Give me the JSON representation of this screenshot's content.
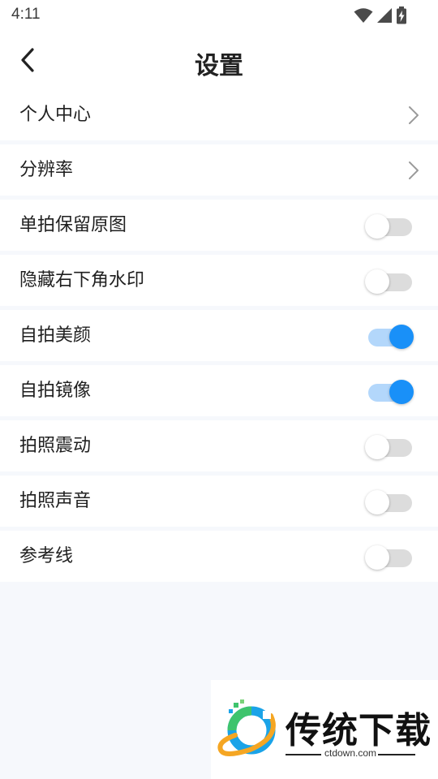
{
  "status_bar": {
    "time": "4:11"
  },
  "header": {
    "title": "设置"
  },
  "settings": [
    {
      "label": "个人中心",
      "control": "chevron"
    },
    {
      "label": "分辨率",
      "control": "chevron"
    },
    {
      "label": "单拍保留原图",
      "control": "toggle",
      "on": false
    },
    {
      "label": "隐藏右下角水印",
      "control": "toggle",
      "on": false
    },
    {
      "label": "自拍美颜",
      "control": "toggle",
      "on": true
    },
    {
      "label": "自拍镜像",
      "control": "toggle",
      "on": true
    },
    {
      "label": "拍照震动",
      "control": "toggle",
      "on": false
    },
    {
      "label": "拍照声音",
      "control": "toggle",
      "on": false
    },
    {
      "label": "参考线",
      "control": "toggle",
      "on": false
    }
  ],
  "watermark": {
    "name": "传统下载",
    "url": "ctdown.com"
  },
  "colors": {
    "accent": "#1990f8",
    "accent_track": "#b3d7fb",
    "off_track": "#dcdcdc",
    "background": "#f6f8fc"
  }
}
